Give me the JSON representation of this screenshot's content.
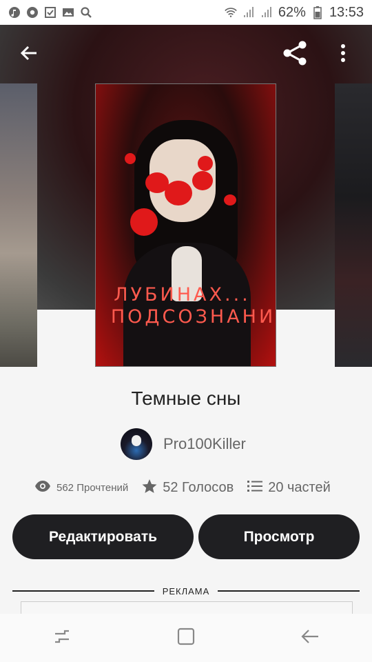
{
  "status_bar": {
    "battery": "62%",
    "time": "13:53",
    "left_icons": [
      "music-note-icon",
      "chrome-icon",
      "checkbox-icon",
      "image-icon",
      "search-icon"
    ],
    "right_icons": [
      "wifi-icon",
      "signal-icon",
      "signal-icon-2"
    ]
  },
  "toolbar": {
    "back": "back-arrow-icon",
    "share": "share-icon",
    "more": "more-vertical-icon"
  },
  "cover": {
    "line1": "ЛУБИНАХ...",
    "line2": "ПОДСОЗНАНИ"
  },
  "story": {
    "title": "Темные сны",
    "author": "Pro100Killer"
  },
  "stats": {
    "reads": "562 Прочтений",
    "votes": "52 Голосов",
    "parts": "20 частей"
  },
  "buttons": {
    "edit": "Редактировать",
    "view": "Просмотр"
  },
  "ad": {
    "label": "РЕКЛАМА"
  },
  "nav": {
    "recents": "recents-icon",
    "home": "home-icon",
    "back": "nav-back-icon"
  },
  "colors": {
    "button_bg": "#1f1f22",
    "cover_red": "#b3100f",
    "cover_text": "#ff5a4e"
  }
}
